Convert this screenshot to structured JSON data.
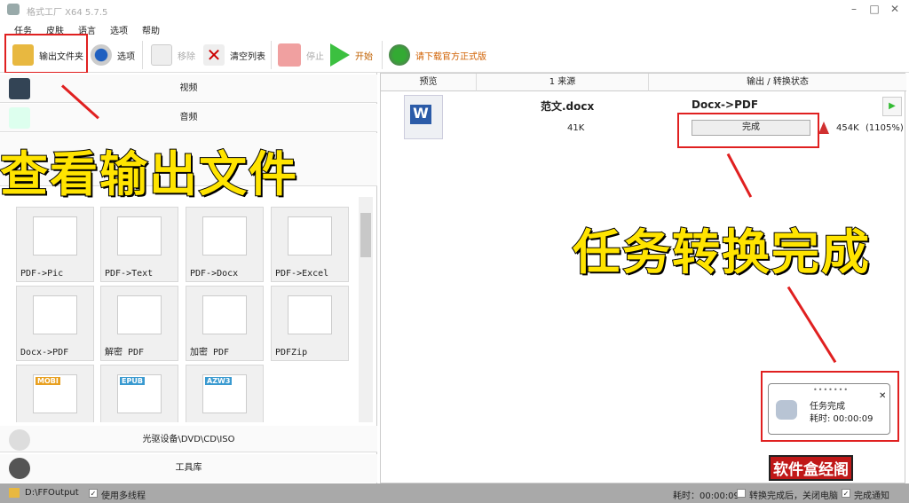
{
  "window": {
    "title": "格式工厂 X64 5.7.5"
  },
  "menu": [
    "任务",
    "皮肤",
    "语言",
    "选项",
    "帮助"
  ],
  "toolbar": {
    "output_folder": "输出文件夹",
    "options": "选项",
    "remove": "移除",
    "clear_list": "清空列表",
    "stop": "停止",
    "start": "开始",
    "download": "请下载官方正式版"
  },
  "categories": {
    "video": "视频",
    "audio": "音频",
    "rom": "光驱设备\\DVD\\CD\\ISO",
    "tools": "工具库"
  },
  "tiles": [
    {
      "label": "PDF->Pic"
    },
    {
      "label": "PDF->Text"
    },
    {
      "label": "PDF->Docx"
    },
    {
      "label": "PDF->Excel"
    },
    {
      "label": "Docx->PDF"
    },
    {
      "label": "解密 PDF"
    },
    {
      "label": "加密 PDF"
    },
    {
      "label": "PDFZip"
    },
    {
      "label": "",
      "badge": "MOBI"
    },
    {
      "label": "",
      "badge": "EPUB"
    },
    {
      "label": "",
      "badge": "AZW3"
    }
  ],
  "table": {
    "headers": [
      "预览",
      "1 来源",
      "输出 / 转换状态"
    ],
    "row": {
      "source_name": "范文.docx",
      "source_size": "41K",
      "output_type": "Docx->PDF",
      "status": "完成",
      "output_size": "454K",
      "ratio": "(1105%)"
    }
  },
  "notification": {
    "title": "任务完成",
    "elapsed": "耗时: 00:00:09"
  },
  "overlay": {
    "left_caption": "查看输出文件",
    "right_caption": "任务转换完成",
    "watermark": "软件盒经阁"
  },
  "status": {
    "path": "D:\\FFOutput",
    "multithread": "使用多线程",
    "elapsed": "耗时：00:00:09",
    "shutdown": "转换完成后，关闭电脑",
    "notify": "完成通知"
  },
  "colors": {
    "accent_red": "#e02020",
    "caption": "#ffe400"
  }
}
